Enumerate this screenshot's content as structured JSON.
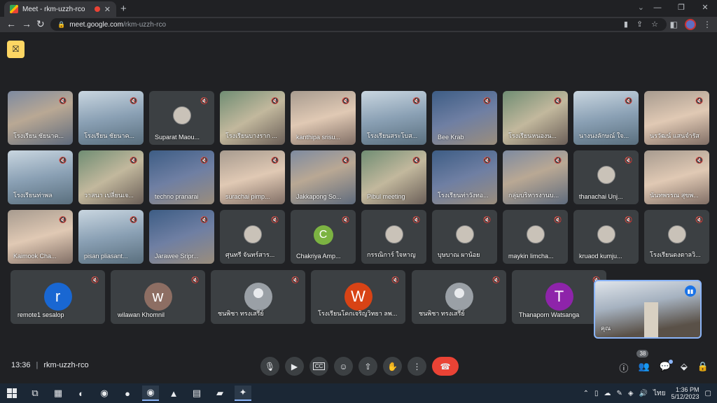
{
  "browser": {
    "tab_title": "Meet - rkm-uzzh-rco",
    "url_host": "meet.google.com",
    "url_path": "/rkm-uzzh-rco"
  },
  "grid": [
    {
      "name": "โรงเรียน ชัยนาค...",
      "type": "video",
      "v": "v1"
    },
    {
      "name": "โรงเรียน ชัยนาค...",
      "type": "video",
      "v": "v2"
    },
    {
      "name": "Suparat Maou...",
      "type": "photo"
    },
    {
      "name": "โรงเรียนบางราก ...",
      "type": "video",
      "v": "v3"
    },
    {
      "name": "kanthipa srisu...",
      "type": "video",
      "v": "v4"
    },
    {
      "name": "โรงเรียนสระโบส...",
      "type": "video",
      "v": "v2"
    },
    {
      "name": "Bee Krab",
      "type": "video",
      "v": "v5"
    },
    {
      "name": "โรงเรียนหนองน...",
      "type": "video",
      "v": "v3"
    },
    {
      "name": "นางนงลักษณ์ ใจ...",
      "type": "video",
      "v": "v2"
    },
    {
      "name": "นรวัฒน์ แสนจำรัส",
      "type": "video",
      "v": "v4"
    },
    {
      "name": "โรงเรียนท่าพล",
      "type": "video",
      "v": "v2"
    },
    {
      "name": "วาสนา เปลี่ยนเจ...",
      "type": "video",
      "v": "v3"
    },
    {
      "name": "techno pranarai",
      "type": "video",
      "v": "v5"
    },
    {
      "name": "surachai pimp...",
      "type": "video",
      "v": "v4"
    },
    {
      "name": "Jakkapong So...",
      "type": "video",
      "v": "v1"
    },
    {
      "name": "Pibul meeting",
      "type": "video",
      "v": "v3"
    },
    {
      "name": "โรงเรียนท่าวังทอ...",
      "type": "video",
      "v": "v5"
    },
    {
      "name": "กลุ่มบริหารงานบ...",
      "type": "video",
      "v": "v1"
    },
    {
      "name": "thanachai Unj...",
      "type": "photo"
    },
    {
      "name": "นันทพรรณ สุขพ...",
      "type": "video",
      "v": "v4"
    },
    {
      "name": "Kaimook Cha...",
      "type": "video",
      "v": "v4"
    },
    {
      "name": "pisan pliasant...",
      "type": "video",
      "v": "v2"
    },
    {
      "name": "Jarawee Sripr...",
      "type": "video",
      "v": "v5"
    },
    {
      "name": "ศุนทรี จันทร์สาร...",
      "type": "photo"
    },
    {
      "name": "Chakriya Amp...",
      "type": "avatar",
      "letter": "C",
      "color": "#7cb342"
    },
    {
      "name": "กรรณิการ์ ใจหาญ",
      "type": "photo"
    },
    {
      "name": "บุษบาณ ผาน้อย",
      "type": "photo"
    },
    {
      "name": "maykin limcha...",
      "type": "photo"
    },
    {
      "name": "kruaod kumju...",
      "type": "photo"
    },
    {
      "name": "โรงเรียนดงตาลวิ...",
      "type": "photo"
    }
  ],
  "bottom_row": [
    {
      "name": "remote1 sesalop",
      "type": "avatar",
      "letter": "r",
      "color": "#1967d2"
    },
    {
      "name": "wilawan Khomnil",
      "type": "avatar",
      "letter": "w",
      "color": "#8d6e63"
    },
    {
      "name": "ชนพิชา ทรงเสรีย์",
      "type": "grey",
      "letter": ""
    },
    {
      "name": "โรงเรียนโคกเจริญวิทยา ลพ...",
      "type": "avatar",
      "letter": "W",
      "color": "#d84315"
    },
    {
      "name": "ชนพิชา ทรงเสรีย์",
      "type": "grey",
      "letter": ""
    },
    {
      "name": "Thanaporn Watsanga",
      "type": "avatar",
      "letter": "T",
      "color": "#8e24aa"
    }
  ],
  "self_view": {
    "name": "คุณ"
  },
  "controls": {
    "time": "13:36",
    "separator": "|",
    "meeting_code": "rkm-uzzh-rco",
    "participants_count": "38"
  },
  "taskbar": {
    "time": "1:36 PM",
    "date": "5/12/2023",
    "lang": "ไทย"
  },
  "colors": {
    "accent": "#8ab4f8",
    "end_call": "#ea4335",
    "page_bg": "#202124"
  }
}
